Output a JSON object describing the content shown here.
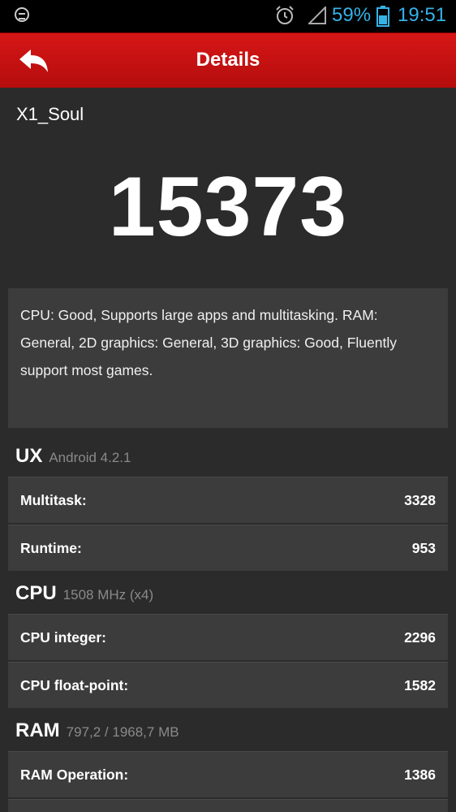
{
  "status_bar": {
    "battery_percent": "59%",
    "time": "19:51",
    "icons": [
      "notification-icon",
      "alarm-icon",
      "signal-icon",
      "battery-icon"
    ]
  },
  "header": {
    "title": "Details",
    "back_icon": "back-arrow-icon"
  },
  "device": {
    "name": "X1_Soul",
    "score": "15373"
  },
  "summary": "CPU: Good, Supports large apps and multitasking. RAM: General, 2D graphics: General, 3D graphics: Good, Fluently support most games.",
  "sections": {
    "ux": {
      "title": "UX",
      "subtitle": "Android 4.2.1",
      "rows": [
        {
          "label": "Multitask:",
          "value": "3328"
        },
        {
          "label": "Runtime:",
          "value": "953"
        }
      ]
    },
    "cpu": {
      "title": "CPU",
      "subtitle": "1508 MHz (x4)",
      "rows": [
        {
          "label": "CPU integer:",
          "value": "2296"
        },
        {
          "label": "CPU float-point:",
          "value": "1582"
        }
      ]
    },
    "ram": {
      "title": "RAM",
      "subtitle": "797,2 / 1968,7 MB",
      "rows": [
        {
          "label": "RAM Operation:",
          "value": "1386"
        }
      ]
    }
  },
  "colors": {
    "header_red": "#d61616",
    "status_blue": "#35b2e6",
    "background": "#2b2b2b",
    "card": "#3c3c3c"
  }
}
